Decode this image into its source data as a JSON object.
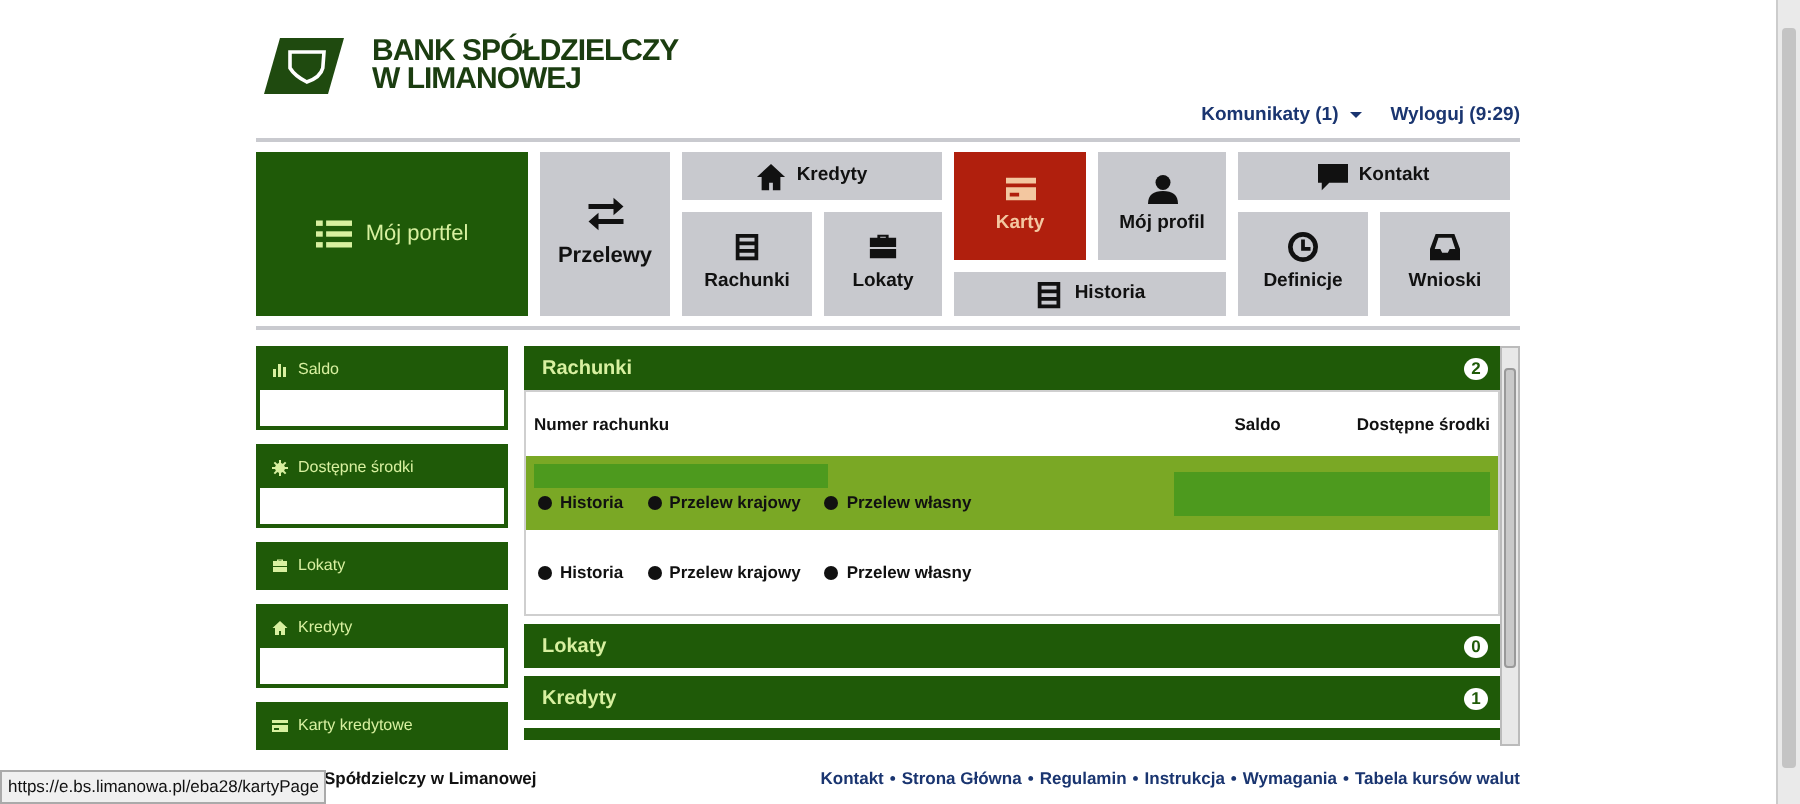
{
  "logo": {
    "line_1": "BANK SPÓŁDZIELCZY",
    "line_2": "W LIMANOWEJ"
  },
  "top_links": [
    {
      "label": "Komunikaty (1)",
      "dropdown": true
    },
    {
      "label": "Wyloguj (9:29)",
      "dropdown": false
    }
  ],
  "tiles": [
    {
      "label": "Mój portfel",
      "kind": "primary",
      "selected": false
    },
    {
      "label": "Przelewy",
      "kind": "large",
      "selected": false
    },
    {
      "label": "Kredyty",
      "kind": "normal",
      "selected": false
    },
    {
      "label": "Rachunki",
      "kind": "normal",
      "selected": false
    },
    {
      "label": "Lokaty",
      "kind": "normal",
      "selected": false
    },
    {
      "label": "Karty",
      "kind": "normal",
      "selected": true
    },
    {
      "label": "Mój profil",
      "kind": "normal",
      "selected": false
    },
    {
      "label": "Historia",
      "kind": "normal",
      "selected": false
    },
    {
      "label": "Kontakt",
      "kind": "normal",
      "selected": false
    },
    {
      "label": "Definicje",
      "kind": "normal",
      "selected": false
    },
    {
      "label": "Wnioski",
      "kind": "normal",
      "selected": false
    }
  ],
  "sidebar": [
    {
      "title": "Saldo",
      "kind": "with_value"
    },
    {
      "title": "Dostępne środki",
      "kind": "with_value"
    },
    {
      "title": "Lokaty",
      "kind": "header_only"
    },
    {
      "title": "Kredyty",
      "kind": "with_value"
    },
    {
      "title": "Karty kredytowe",
      "kind": "header_only"
    }
  ],
  "sections": [
    {
      "title": "Rachunki",
      "count": "2",
      "expanded": true
    },
    {
      "title": "Lokaty",
      "count": "0",
      "expanded": false
    },
    {
      "title": "Kredyty",
      "count": "1",
      "expanded": false
    }
  ],
  "accounts_table": {
    "columns": [
      "Numer rachunku",
      "Saldo",
      "Dostępne środki"
    ],
    "rows": [
      {
        "selected": true,
        "links": [
          "Historia",
          "Przelew krajowy",
          "Przelew własny"
        ]
      },
      {
        "selected": false,
        "links": [
          "Historia",
          "Przelew krajowy",
          "Przelew własny"
        ]
      }
    ]
  },
  "footer": {
    "bank_name": "Spółdzielczy w Limanowej",
    "separator": "•",
    "links": [
      "Kontakt",
      "Strona Główna",
      "Regulamin",
      "Instrukcja",
      "Wymagania",
      "Tabela kursów walut"
    ]
  },
  "status_url": "https://e.bs.limanowa.pl/eba28/kartyPage"
}
